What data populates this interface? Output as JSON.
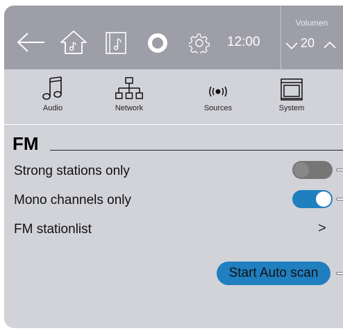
{
  "header": {
    "time": "12:00",
    "volume_label": "Volumen",
    "volume_value": "20"
  },
  "categories": [
    {
      "label": "Audio",
      "icon": "music-note-icon"
    },
    {
      "label": "Network",
      "icon": "network-icon"
    },
    {
      "label": "Sources",
      "icon": "broadcast-icon"
    },
    {
      "label": "System",
      "icon": "system-icon"
    }
  ],
  "section": {
    "title": "FM"
  },
  "settings": {
    "strong_stations": {
      "label": "Strong stations only",
      "enabled": false
    },
    "mono_channels": {
      "label": "Mono channels only",
      "enabled": true
    },
    "station_list": {
      "label": "FM stationlist",
      "chevron": ">"
    }
  },
  "actions": {
    "start_scan_label": "Start Auto scan"
  },
  "colors": {
    "topbar": "#9e9ea9",
    "panel": "#d2d3d9",
    "accent": "#1f7fbf"
  }
}
